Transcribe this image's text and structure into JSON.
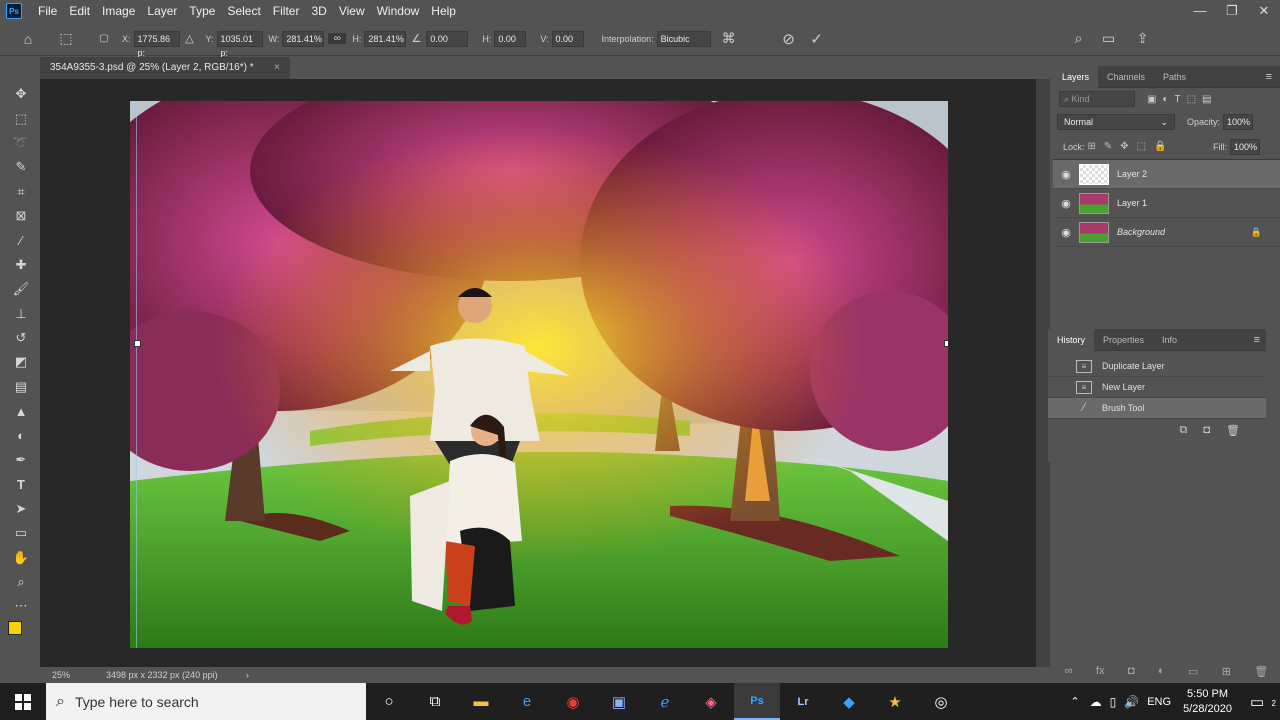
{
  "app": {
    "logo": "Ps"
  },
  "menu": [
    "File",
    "Edit",
    "Image",
    "Layer",
    "Type",
    "Select",
    "Filter",
    "3D",
    "View",
    "Window",
    "Help"
  ],
  "window_controls": {
    "minimize": "—",
    "restore": "❐",
    "close": "✕"
  },
  "options": {
    "x_label": "X:",
    "x_value": "1775.86 p:",
    "y_label": "Y:",
    "y_value": "1035.01 p:",
    "w_label": "W:",
    "w_value": "281.41%",
    "h_label": "H:",
    "h_value": "281.41%",
    "angle_value": "0.00",
    "hskew_label": "H:",
    "hskew_value": "0.00",
    "vskew_label": "V:",
    "vskew_value": "0.00",
    "interp_label": "Interpolation:",
    "interp_value": "Bicubic"
  },
  "document_tab": {
    "title": "354A9355-3.psd @ 25% (Layer 2, RGB/16*) *",
    "close": "×"
  },
  "status": {
    "zoom": "25%",
    "dimensions": "3498 px x 2332 px (240 ppi)"
  },
  "layers_panel": {
    "tabs": [
      "Layers",
      "Channels",
      "Paths"
    ],
    "search_placeholder": "Kind",
    "blend_mode": "Normal",
    "opacity_label": "Opacity:",
    "opacity_value": "100%",
    "lock_label": "Lock:",
    "fill_label": "Fill:",
    "fill_value": "100%",
    "layers": [
      {
        "name": "Layer 2",
        "selected": true
      },
      {
        "name": "Layer 1",
        "selected": false
      },
      {
        "name": "Background",
        "selected": false
      }
    ]
  },
  "history_panel": {
    "tabs": [
      "History",
      "Properties",
      "Info"
    ],
    "items": [
      {
        "label": "Duplicate Layer",
        "selected": false
      },
      {
        "label": "New Layer",
        "selected": false
      },
      {
        "label": "Brush Tool",
        "selected": true
      }
    ]
  },
  "taskbar": {
    "search_placeholder": "Type here to search",
    "time": "5:50 PM",
    "date": "5/28/2020",
    "language": "ENG",
    "notification_count": "2"
  },
  "colors": {
    "accent": "#31a8ff",
    "foreground": "#f5d400",
    "background_swatch": "#ffffff"
  }
}
